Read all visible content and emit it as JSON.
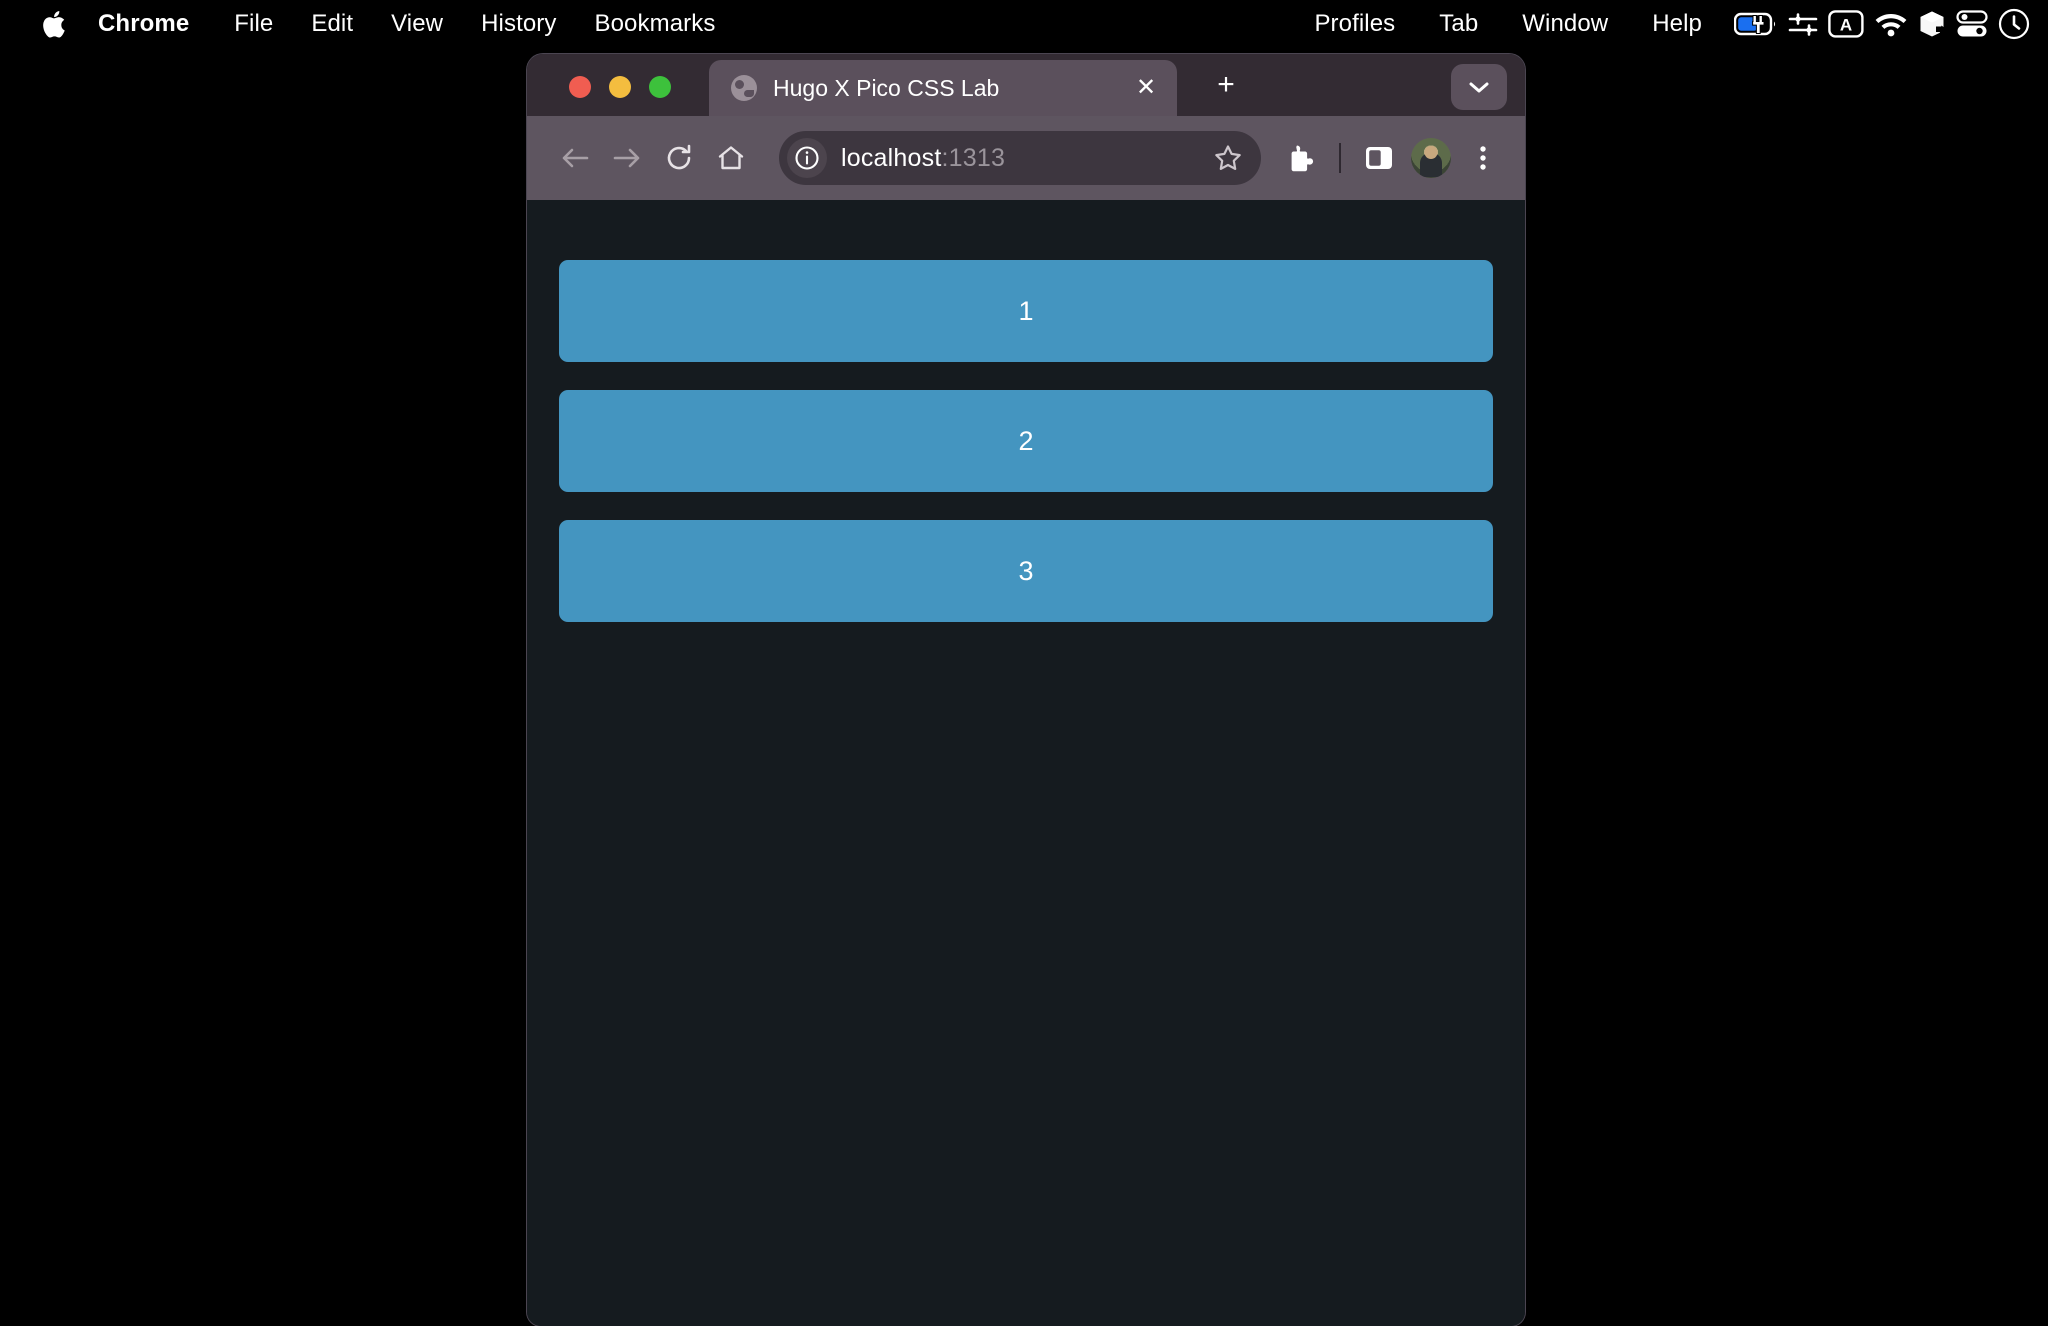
{
  "menubar": {
    "apple_icon": "apple-logo",
    "app_name": "Chrome",
    "items": [
      "File",
      "Edit",
      "View",
      "History",
      "Bookmarks"
    ],
    "right_items": [
      "Profiles",
      "Tab",
      "Window",
      "Help"
    ],
    "status_icons": [
      "battery-charging-icon",
      "control-sliders-icon",
      "keyboard-input-a-icon",
      "wifi-icon",
      "dropbox-box-icon",
      "control-center-icon",
      "siri-clock-icon"
    ]
  },
  "browser": {
    "tab": {
      "title": "Hugo X Pico CSS Lab",
      "favicon": "globe-icon",
      "close_label": "✕"
    },
    "new_tab_label": "+",
    "tab_list_icon": "chevron-down-icon",
    "toolbar": {
      "back_icon": "arrow-left-icon",
      "forward_icon": "arrow-right-icon",
      "reload_icon": "reload-icon",
      "home_icon": "home-icon",
      "site_info_icon": "info-circle-icon",
      "url_host": "localhost",
      "url_port": ":1313",
      "bookmark_icon": "star-icon",
      "extensions_icon": "puzzle-piece-icon",
      "side_panel_icon": "side-panel-icon",
      "profile_icon": "avatar-icon",
      "menu_icon": "three-dot-menu-icon"
    }
  },
  "page": {
    "buttons": [
      {
        "label": "1"
      },
      {
        "label": "2"
      },
      {
        "label": "3"
      }
    ],
    "accent_color": "#4495c0",
    "background_color": "#151b1f"
  }
}
